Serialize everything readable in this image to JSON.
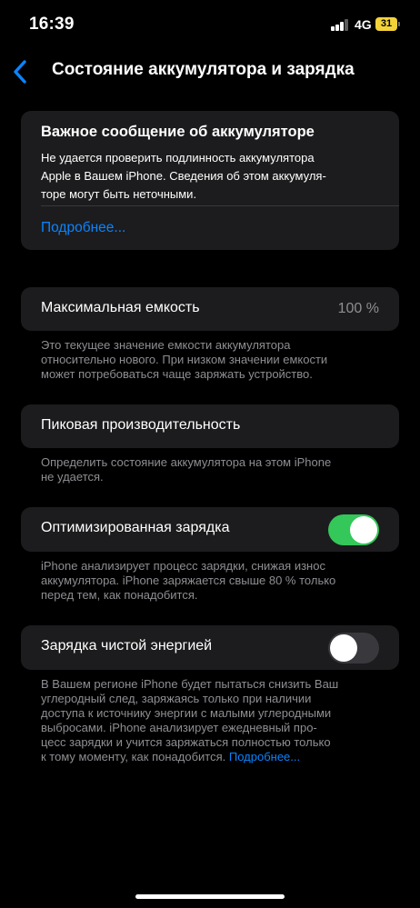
{
  "status_bar": {
    "time": "16:39",
    "network": "4G",
    "battery": "31"
  },
  "nav": {
    "title": "Состояние аккумулятора и зарядка",
    "back_icon": "chevron-left-icon"
  },
  "message_card": {
    "title": "Важное сообщение об аккумуляторе",
    "body_lines": [
      "Не удается проверить подлинность аккумулятора",
      "Apple в Вашем iPhone. Сведения об этом аккумуля-",
      "торе могут быть неточными."
    ],
    "link": "Подробнее..."
  },
  "max_capacity": {
    "label": "Максимальная емкость",
    "value": "100 %",
    "footer_lines": [
      "Это текущее значение емкости аккумулятора",
      "относительно нового. При низком значении емкости",
      "может потребоваться чаще заряжать устройство."
    ]
  },
  "peak_performance": {
    "label": "Пиковая производительность",
    "footer_lines": [
      "Определить состояние аккумулятора на этом iPhone",
      "не удается."
    ]
  },
  "optimized_charging": {
    "label": "Оптимизированная зарядка",
    "enabled": true,
    "footer_lines": [
      "iPhone анализирует процесс зарядки, снижая износ",
      "аккумулятора. iPhone заряжается свыше 80 % только",
      "перед тем, как понадобится."
    ]
  },
  "clean_energy": {
    "label": "Зарядка чистой энергией",
    "enabled": false,
    "footer_lines": [
      "В Вашем регионе iPhone будет пытаться снизить Ваш",
      "углеродный след, заряжаясь только при наличии",
      "доступа к источнику энергии с малыми углеродными",
      "выбросами. iPhone анализирует ежедневный про-",
      "цесс зарядки и учится заряжаться полностью только"
    ],
    "footer_last_line": "к тому моменту, как понадобится.",
    "footer_link": "Подробнее..."
  },
  "colors": {
    "accent": "#0a84ff",
    "toggle_on": "#34c759",
    "card": "#1c1c1e"
  }
}
